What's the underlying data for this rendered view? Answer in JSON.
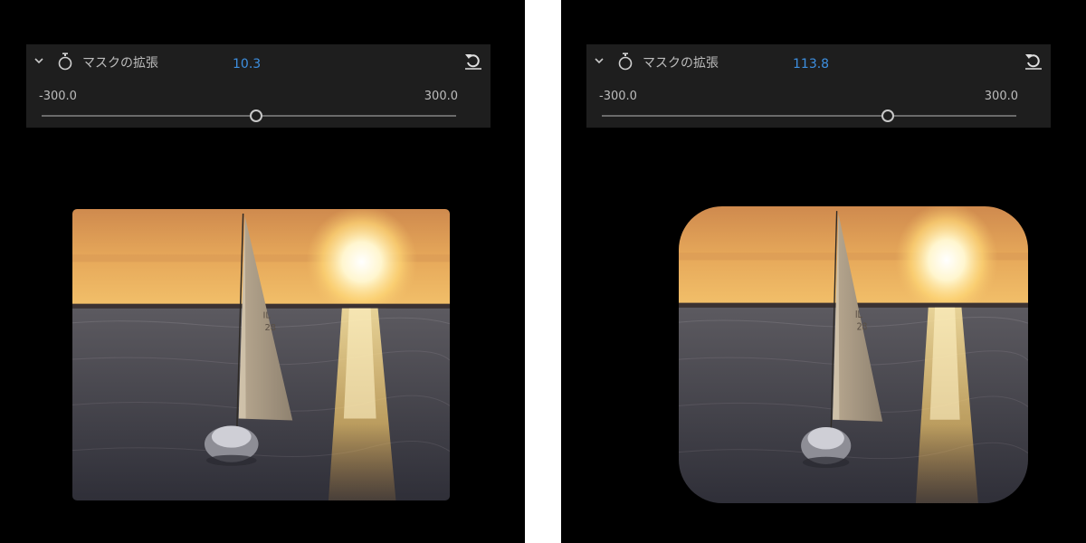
{
  "panels": [
    {
      "label": "マスクの拡張",
      "value": "10.3",
      "min_label": "-300.0",
      "max_label": "300.0",
      "slider": {
        "min": -300.0,
        "max": 300.0,
        "value": 10.3
      },
      "icons": [
        "chevron-down-icon",
        "stopwatch-icon",
        "reset-icon"
      ],
      "preview": "sailboat-sunset"
    },
    {
      "label": "マスクの拡張",
      "value": "113.8",
      "min_label": "-300.0",
      "max_label": "300.0",
      "slider": {
        "min": -300.0,
        "max": 300.0,
        "value": 113.8
      },
      "icons": [
        "chevron-down-icon",
        "stopwatch-icon",
        "reset-icon"
      ],
      "preview": "sailboat-sunset"
    }
  ],
  "colors": {
    "accent": "#3d8fe0",
    "panel_bg": "#1e1e1e",
    "background": "#000000",
    "text": "#bdbdbd"
  }
}
